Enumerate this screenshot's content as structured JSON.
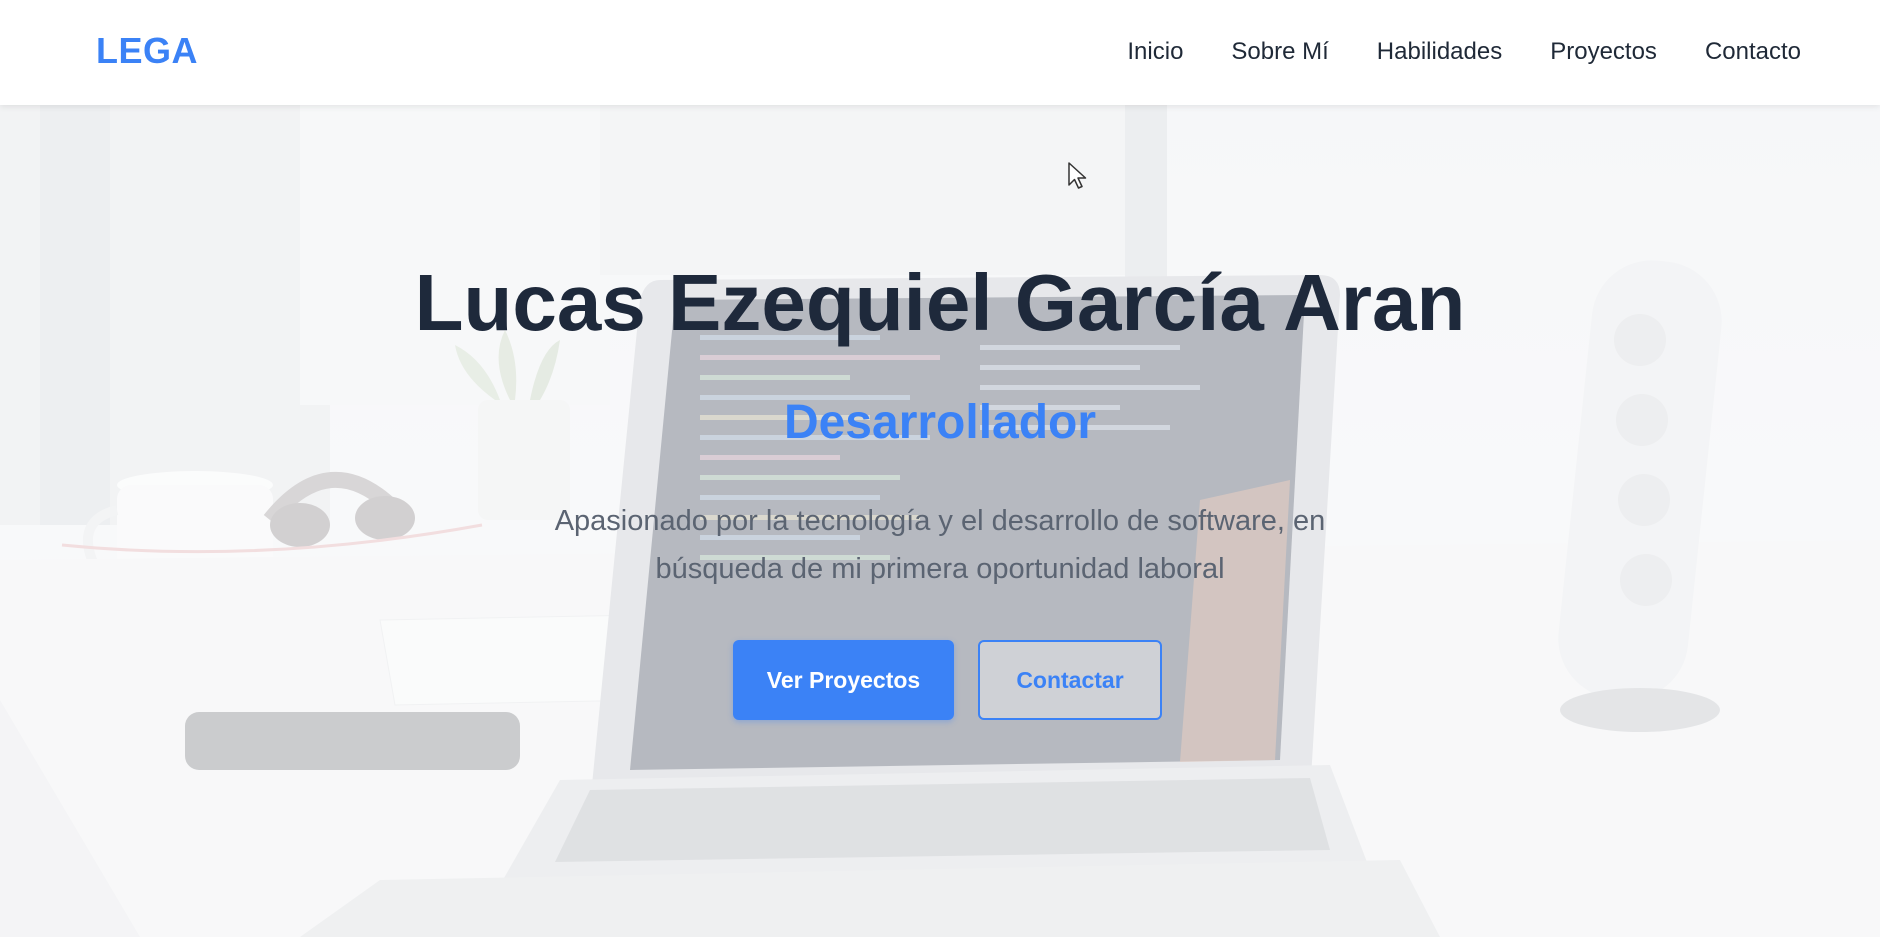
{
  "navbar": {
    "logo": "LEGA",
    "links": [
      "Inicio",
      "Sobre Mí",
      "Habilidades",
      "Proyectos",
      "Contacto"
    ]
  },
  "hero": {
    "name": "Lucas Ezequiel García Aran",
    "role": "Desarrollador",
    "tagline": "Apasionado por la tecnología y el desarrollo de software, en búsqueda de mi primera oportunidad laboral",
    "primary_button": "Ver Proyectos",
    "secondary_button": "Contactar",
    "background_image": "laptop-desk-photo"
  },
  "colors": {
    "accent": "#3b82f6",
    "heading": "#1e293b",
    "body_text": "#5b6472",
    "nav_background": "#ffffff"
  },
  "icons": {
    "cursor": "mouse-pointer-icon"
  }
}
